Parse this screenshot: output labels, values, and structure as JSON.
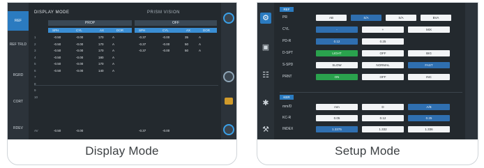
{
  "display_mode": {
    "caption": "Display Mode",
    "title": "DISPLAY MODE",
    "subtitle": "PRISM VISION",
    "left_tabs": [
      "REF",
      "REF TRLD",
      "RGRD",
      "CORT",
      "RDEV"
    ],
    "groups": [
      "PROP",
      "OFF"
    ],
    "headers": [
      "SPH",
      "CYL",
      "AX",
      "DOR",
      "SPH",
      "CYL",
      "AX",
      "DOR"
    ],
    "rows": [
      {
        "idx": "1",
        "a": "-0.50",
        "b": "-0.00",
        "c": "170",
        "d": "A",
        "e": "-0.37",
        "f": "-0.00",
        "g": "35",
        "h": "A"
      },
      {
        "idx": "2",
        "a": "-0.50",
        "b": "-0.00",
        "c": "170",
        "d": "A",
        "e": "-0.37",
        "f": "-0.00",
        "g": "50",
        "h": "A"
      },
      {
        "idx": "3",
        "a": "-0.50",
        "b": "-0.00",
        "c": "170",
        "d": "A",
        "e": "-0.37",
        "f": "-0.00",
        "g": "50",
        "h": "A"
      },
      {
        "idx": "4",
        "a": "-0.50",
        "b": "-0.00",
        "c": "180",
        "d": "A",
        "e": "",
        "f": "",
        "g": "",
        "h": ""
      },
      {
        "idx": "5",
        "a": "-0.50",
        "b": "-0.00",
        "c": "170",
        "d": "A",
        "e": "",
        "f": "",
        "g": "",
        "h": ""
      },
      {
        "idx": "6",
        "a": "-0.50",
        "b": "-0.00",
        "c": "140",
        "d": "A",
        "e": "",
        "f": "",
        "g": "",
        "h": ""
      },
      {
        "idx": "7",
        "a": "",
        "b": "",
        "c": "",
        "d": "",
        "e": "",
        "f": "",
        "g": "",
        "h": ""
      },
      {
        "idx": "8",
        "a": "",
        "b": "",
        "c": "",
        "d": "",
        "e": "",
        "f": "",
        "g": "",
        "h": ""
      },
      {
        "idx": "9",
        "a": "",
        "b": "",
        "c": "",
        "d": "",
        "e": "",
        "f": "",
        "g": "",
        "h": ""
      },
      {
        "idx": "10",
        "a": "",
        "b": "",
        "c": "",
        "d": "",
        "e": "",
        "f": "",
        "g": "",
        "h": ""
      }
    ],
    "avg_row": {
      "idx": "AV",
      "a": "-0.50",
      "b": "-0.00",
      "e": "-0.37",
      "f": "-0.00"
    }
  },
  "setup_mode": {
    "caption": "Setup Mode",
    "sections": [
      "REF",
      "KER"
    ],
    "rows": [
      {
        "label": "PR",
        "cells": [
          {
            "t": "AB",
            "c": "w"
          },
          {
            "t": "S/A",
            "c": "b"
          },
          {
            "t": "S/A",
            "c": "w"
          },
          {
            "t": "BVA",
            "c": "w"
          }
        ]
      },
      {
        "label": "CYL",
        "cells": [
          {
            "t": "-",
            "c": "b"
          },
          {
            "t": "+",
            "c": "w"
          },
          {
            "t": "MIX",
            "c": "w"
          }
        ]
      },
      {
        "label": "PD-R",
        "cells": [
          {
            "t": "0.12",
            "c": "b"
          },
          {
            "t": "0.25",
            "c": "w"
          }
        ]
      },
      {
        "label": "D-SPT",
        "cells": [
          {
            "t": "LIGHT",
            "c": "g"
          },
          {
            "t": "OFF",
            "c": "w"
          },
          {
            "t": "BIG",
            "c": "w"
          }
        ]
      },
      {
        "label": "S-SPD",
        "cells": [
          {
            "t": "SLOW",
            "c": "w"
          },
          {
            "t": "NORMAL",
            "c": "w"
          },
          {
            "t": "FAST",
            "c": "b"
          }
        ]
      },
      {
        "label": "PRNT",
        "cells": [
          {
            "t": "ON",
            "c": "g"
          },
          {
            "t": "OFF",
            "c": "w"
          },
          {
            "t": "INC",
            "c": "w"
          }
        ]
      }
    ],
    "ker_rows": [
      {
        "label": "mm/D",
        "cells": [
          {
            "t": "mm",
            "c": "w"
          },
          {
            "t": "D",
            "c": "w"
          },
          {
            "t": "A/B",
            "c": "b"
          }
        ]
      },
      {
        "label": "KC-R",
        "cells": [
          {
            "t": "0.05",
            "c": "w"
          },
          {
            "t": "0.12",
            "c": "w"
          },
          {
            "t": "0.25",
            "c": "b"
          }
        ]
      },
      {
        "label": "INDEX",
        "cells": [
          {
            "t": "1.3375",
            "c": "b"
          },
          {
            "t": "1.332",
            "c": "w"
          },
          {
            "t": "1.336",
            "c": "w"
          }
        ]
      }
    ]
  }
}
